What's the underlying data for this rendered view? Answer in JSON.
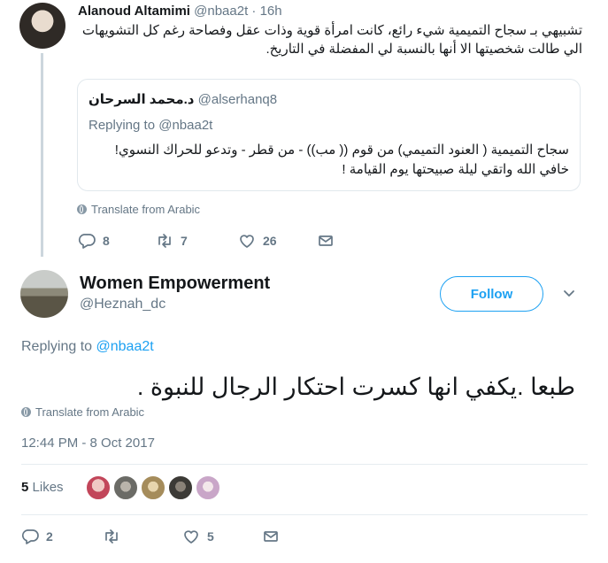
{
  "parent": {
    "name": "Alanoud Altamimi",
    "handle": "@nbaa2t",
    "time": "16h",
    "text": "تشبيهي بـ سجاح التميمية شيء رائع، كانت امرأة قوية وذات عقل وفصاحة رغم كل التشويهات الي طالت شخصيتها الا أنها بالنسبة لي المفضلة في التاريخ.",
    "quote": {
      "name": "د.محمد السرحان",
      "handle": "@alserhanq8",
      "replying_prefix": "Replying to",
      "replying_to": "@nbaa2t",
      "text": "سجاح التميمية ( العنود التميمي) من قوم (( مب)) - من قطر - وتدعو للحراك النسوي! خافي الله واتقي ليلة صبيحتها يوم القيامة !"
    },
    "translate": "Translate from Arabic",
    "stats": {
      "replies": "8",
      "retweets": "7",
      "likes": "26"
    }
  },
  "main": {
    "name": "Women Empowerment",
    "handle": "@Heznah_dc",
    "follow_label": "Follow",
    "replying_prefix": "Replying to",
    "replying_to": "@nbaa2t",
    "text": "طبعا .يكفي انها كسرت احتكار الرجال للنبوة .",
    "translate": "Translate from Arabic",
    "timestamp": "12:44 PM - 8 Oct 2017",
    "likes_count": "5",
    "likes_label": "Likes",
    "stats": {
      "replies": "2",
      "retweets": "",
      "likes": "5"
    }
  },
  "colors": {
    "accent": "#1da1f2",
    "muted": "#657786",
    "text": "#14171a",
    "border": "#e1e8ed"
  },
  "icons": {
    "reply": "reply-icon",
    "retweet": "retweet-icon",
    "like": "heart-icon",
    "message": "envelope-icon",
    "translate": "globe-icon",
    "menu": "chevron-down-icon"
  }
}
